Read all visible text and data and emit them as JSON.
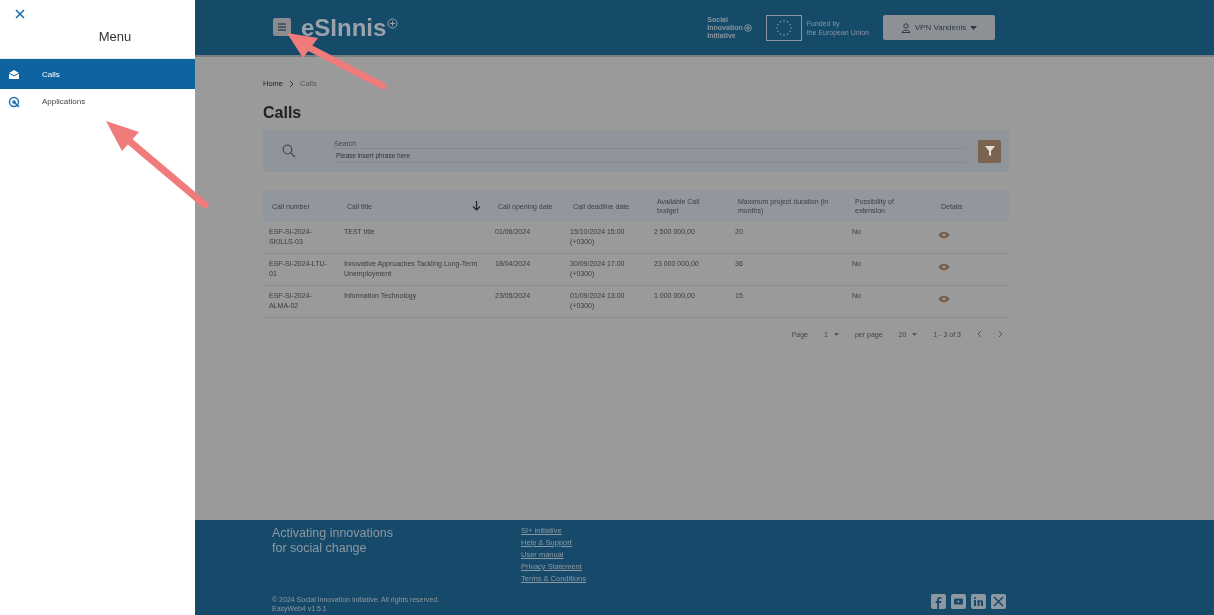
{
  "menu": {
    "title": "Menu",
    "items": [
      {
        "label": "Calls",
        "selected": true
      },
      {
        "label": "Applications",
        "selected": false
      }
    ]
  },
  "header": {
    "logo": "eSInnis",
    "initiative": [
      "Social",
      "Innovation",
      "Initiative"
    ],
    "funding": [
      "Funded by",
      "the European Union"
    ],
    "user": "VPN Vandenis"
  },
  "breadcrumb": [
    {
      "label": "Home",
      "current": false
    },
    {
      "label": "Calls",
      "current": true
    }
  ],
  "page_title": "Calls",
  "search": {
    "label": "Search",
    "placeholder": "Please insert phrase here"
  },
  "table": {
    "columns": [
      {
        "label": "Call number",
        "sorted": false
      },
      {
        "label": "Call title",
        "sorted": true
      },
      {
        "label": "Call opening date",
        "sorted": false
      },
      {
        "label": "Call deadline date",
        "sorted": false
      },
      {
        "label": "Available Call budget",
        "sorted": false
      },
      {
        "label": "Maximum project duration (in months)",
        "sorted": false
      },
      {
        "label": "Possibility of extension",
        "sorted": false
      },
      {
        "label": "Details",
        "sorted": false
      }
    ],
    "rows": [
      [
        "ESF-SI-2024-SKILLS-03",
        "TEST title",
        "01/06/2024",
        "15/10/2024 15:00 (+0300)",
        "2 500 000,00",
        "20",
        "No"
      ],
      [
        "ESF-SI-2024-LTU-01",
        "Innovative Approaches Tackling Long-Term Unemployment",
        "18/04/2024",
        "30/09/2024 17:00 (+0300)",
        "23 000 000,00",
        "36",
        "No"
      ],
      [
        "ESF-SI-2024-ALMA-02",
        "Information Technology",
        "23/05/2024",
        "01/09/2024 13:00 (+0300)",
        "1 000 000,00",
        "15",
        "No"
      ]
    ]
  },
  "pagination": {
    "page_label": "Page",
    "page": "1",
    "per_page_label": "per page",
    "per_page": "20",
    "range": "1 - 3 of 3"
  },
  "footer": {
    "tagline": [
      "Activating innovations",
      "for social change"
    ],
    "links": [
      "SI+ initiative",
      "Help & Support",
      "User manual",
      "Privacy Statement",
      "Terms & Conditions"
    ],
    "copyright": "© 2024 Social Innovation Initiative. All rights reserved.",
    "version": "EasyWeb4 v1.5.1"
  }
}
